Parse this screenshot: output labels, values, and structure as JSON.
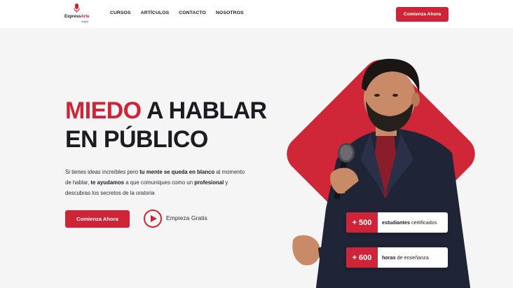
{
  "header": {
    "logo": {
      "part1": "Express",
      "part2": "Arte",
      "sub": "mejor"
    },
    "nav": [
      "CURSOS",
      "ARTÍCULOS",
      "CONTACTO",
      "NOSOTROS"
    ],
    "cta_label": "Comienza Ahora"
  },
  "hero": {
    "headline_accent": "MIEDO",
    "headline_rest": " A HABLAR",
    "headline_line2": "EN PÚBLICO",
    "desc": {
      "t1": "Si tienes ideas increíbles pero ",
      "b1": "tu mente se queda en blanco",
      "t2": " al momento de hablar, ",
      "b2": "te ayudamos",
      "t3": " a que comuniques como un ",
      "b3": "profesional",
      "t4": " y descubras los secretos de la oratoria"
    },
    "cta_label": "Comienza Ahora",
    "play_label": "Empieza Gratis"
  },
  "stats": [
    {
      "number": "+ 500",
      "bold": "estudiantes",
      "rest": " certificados"
    },
    {
      "number": "+ 600",
      "bold": "horas",
      "rest": " de enseñanza"
    }
  ],
  "colors": {
    "accent": "#cd2537",
    "background": "#f5f5f6",
    "text": "#1b1b22"
  },
  "icons": {
    "logo": "microphone-icon",
    "play": "play-icon"
  }
}
